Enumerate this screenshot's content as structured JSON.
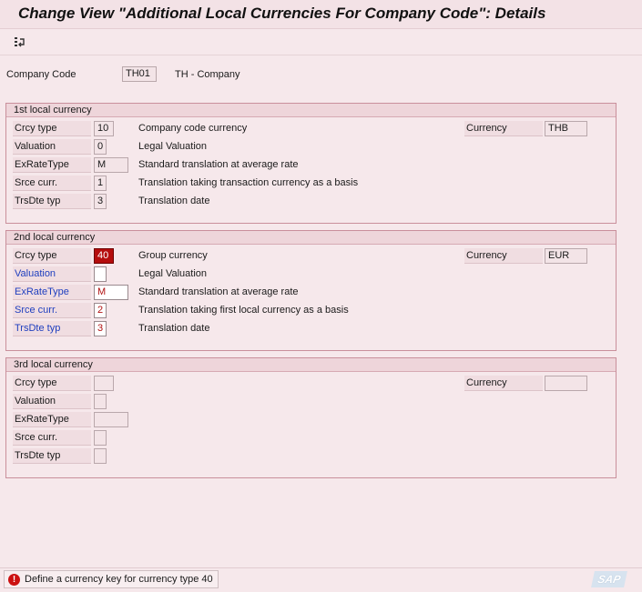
{
  "title": "Change View \"Additional Local Currencies For Company Code\": Details",
  "toolbar": {
    "icons": [
      "other-entry-icon"
    ]
  },
  "header": {
    "company_code_label": "Company Code",
    "company_code_value": "TH01",
    "company_name": "TH - Company"
  },
  "groups": [
    {
      "title": "1st local currency",
      "crcy_type_label": "Crcy type",
      "crcy_type_value": "10",
      "crcy_type_desc": "Company code currency",
      "currency_label": "Currency",
      "currency_value": "THB",
      "valuation_label": "Valuation",
      "valuation_value": "0",
      "valuation_desc": "Legal Valuation",
      "exrate_label": "ExRateType",
      "exrate_value": "M",
      "exrate_desc": "Standard translation at average rate",
      "srce_label": "Srce curr.",
      "srce_value": "1",
      "srce_desc": "Translation taking transaction currency as a basis",
      "trsdte_label": "TrsDte typ",
      "trsdte_value": "3",
      "trsdte_desc": "Translation date"
    },
    {
      "title": "2nd local currency",
      "crcy_type_label": "Crcy type",
      "crcy_type_value": "40",
      "crcy_type_desc": "Group currency",
      "currency_label": "Currency",
      "currency_value": "EUR",
      "valuation_label": "Valuation",
      "valuation_value": "",
      "valuation_desc": "Legal Valuation",
      "exrate_label": "ExRateType",
      "exrate_value": "M",
      "exrate_desc": "Standard translation at average rate",
      "srce_label": "Srce curr.",
      "srce_value": "2",
      "srce_desc": "Translation taking first local currency as a basis",
      "trsdte_label": "TrsDte typ",
      "trsdte_value": "3",
      "trsdte_desc": "Translation date"
    },
    {
      "title": "3rd local currency",
      "crcy_type_label": "Crcy type",
      "crcy_type_value": "",
      "currency_label": "Currency",
      "currency_value": "",
      "valuation_label": "Valuation",
      "valuation_value": "",
      "exrate_label": "ExRateType",
      "exrate_value": "",
      "srce_label": "Srce curr.",
      "srce_value": "",
      "trsdte_label": "TrsDte typ",
      "trsdte_value": ""
    }
  ],
  "status": {
    "icon": "error-icon",
    "icon_glyph": "!",
    "message": "Define a currency key for currency type 40",
    "logo": "SAP"
  },
  "colors": {
    "background": "#f6e8eb",
    "group_border": "#c98f9b",
    "required_label": "#1f3fbf",
    "error_field": "#b50d0d"
  }
}
